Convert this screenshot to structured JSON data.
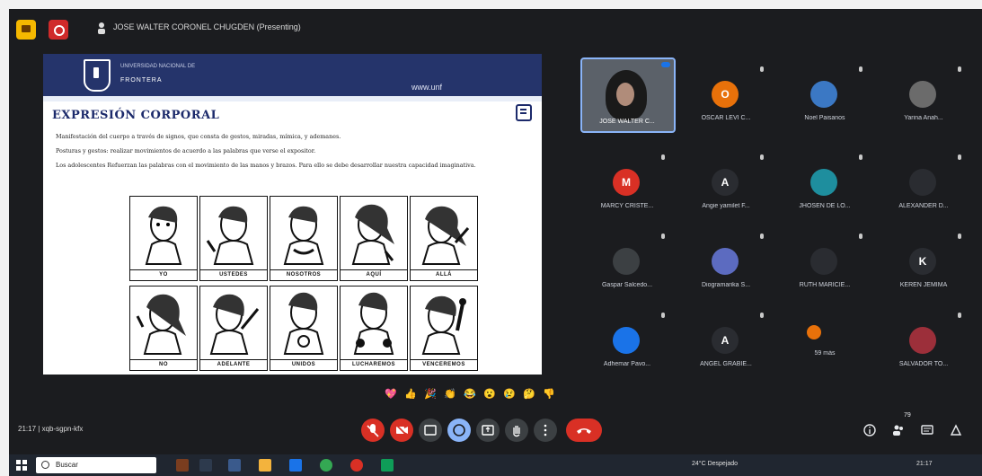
{
  "meeting": {
    "title": "JOSE WALTER CORONEL CHUGDEN (Presenting)",
    "time": "21:17",
    "meeting_code": "xqb-sgpn-kfx"
  },
  "slide": {
    "institution_top": "UNIVERSIDAD NACIONAL DE",
    "institution_name": "FRONTERA",
    "url": "www.unf",
    "heading": "EXPRESIÓN CORPORAL",
    "para1": "Manifestación del cuerpo a través de signos, que consta de gestos, miradas, mímica, y ademanes.",
    "para2": "Posturas y gestos: realizar movimientos de acuerdo a las palabras que verse el expositor.",
    "para3": "Los adolescentes Refuerzan las palabras con el movimiento de las manos y brazos. Para ello se debe desarrollar nuestra capacidad imaginativa.",
    "grid_captions": [
      "YO",
      "USTEDES",
      "NOSOTROS",
      "AQUÍ",
      "ALLÁ",
      "NO",
      "ADELANTE",
      "UNIDOS",
      "LUCHAREMOS",
      "VENCEREMOS"
    ]
  },
  "self_tile": {
    "name": "JOSE WALTER C..."
  },
  "participants": [
    {
      "name": "OSCAR LEVI C...",
      "initial": "O",
      "color": "#e8710a"
    },
    {
      "name": "Noel Paisanos",
      "initial": "",
      "color": "#3b78c4"
    },
    {
      "name": "Yarina Anah...",
      "initial": "",
      "color": "#6b6b6b"
    },
    {
      "name": "MARCY CRISTE...",
      "initial": "M",
      "color": "#d93025"
    },
    {
      "name": "Angie yamilet F...",
      "initial": "A",
      "color": "#2a2c31"
    },
    {
      "name": "JHOSEN DE LO...",
      "initial": "",
      "color": "#1e8e9e"
    },
    {
      "name": "ALEXANDER D...",
      "initial": "",
      "color": "#2a2c31"
    },
    {
      "name": "Gaspar Salcedo...",
      "initial": "",
      "color": "#3c4043"
    },
    {
      "name": "Diogramarika S...",
      "initial": "",
      "color": "#5c6bc0"
    },
    {
      "name": "RUTH MARICIE...",
      "initial": "",
      "color": "#2a2c31"
    },
    {
      "name": "KEREN JEMIMA",
      "initial": "K",
      "color": "#2a2c31"
    },
    {
      "name": "Adhemar Pavo...",
      "initial": "",
      "color": "#1a73e8"
    },
    {
      "name": "ANGEL GRABIE...",
      "initial": "A",
      "color": "#2a2c31"
    },
    {
      "name": "59 más",
      "initial": "",
      "color": "#e8710a"
    },
    {
      "name": "SALVADOR TO...",
      "initial": "",
      "color": "#9c2f3a"
    }
  ],
  "reactions": [
    "💖",
    "👍",
    "🎉",
    "👏",
    "😂",
    "😮",
    "😢",
    "🤔",
    "👎"
  ],
  "controls": {
    "participant_count": "79",
    "taskbar_search": "Buscar",
    "weather": "24°C Despejado",
    "clock": "21:17"
  },
  "icons": {
    "mic": "mic-off-icon",
    "camera": "camera-off-icon",
    "captions": "captions-icon",
    "raise_hand": "hand-icon",
    "present": "present-icon",
    "more": "more-vert-icon",
    "leave": "call-end-icon"
  },
  "colors": {
    "accent": "#1a73e8",
    "danger": "#d93025",
    "background": "#1b1c1f",
    "slide_header": "#25346b"
  }
}
